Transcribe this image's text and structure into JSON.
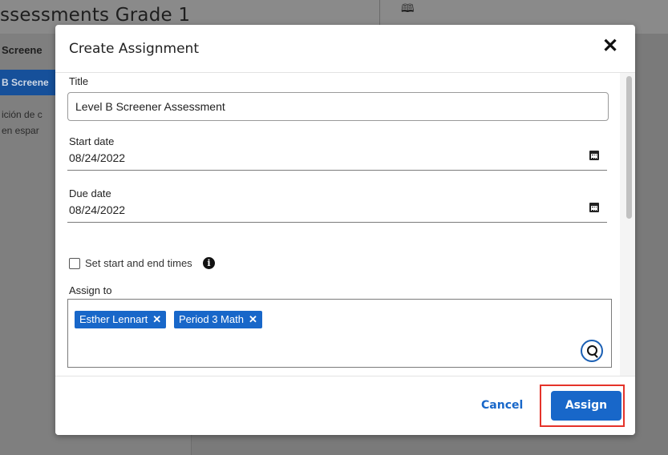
{
  "background": {
    "page_title": "ssessments Grade 1",
    "left_section_label": "Screene",
    "left_active_item": "B Screene",
    "left_desc_line1": "ición de c",
    "left_desc_line2": "en espar",
    "book_icon": "book-icon"
  },
  "modal": {
    "title": "Create Assignment",
    "close_icon": "close-icon",
    "title_label": "Title",
    "title_value": "Level B Screener Assessment",
    "start_date_label": "Start date",
    "start_date_value": "08/24/2022",
    "due_date_label": "Due date",
    "due_date_value": "08/24/2022",
    "calendar_icon": "calendar-icon",
    "set_times_label": "Set start and end times",
    "info_icon": "info-icon",
    "assign_to_label": "Assign to",
    "assignees": [
      {
        "label": "Esther Lennart",
        "remove": "✕"
      },
      {
        "label": "Period 3 Math",
        "remove": "✕"
      }
    ],
    "search_icon": "search-icon"
  },
  "footer": {
    "cancel_label": "Cancel",
    "assign_label": "Assign"
  },
  "colors": {
    "accent": "#1867c9",
    "highlight": "#e5332a",
    "overlay": "#7a7a7a"
  }
}
